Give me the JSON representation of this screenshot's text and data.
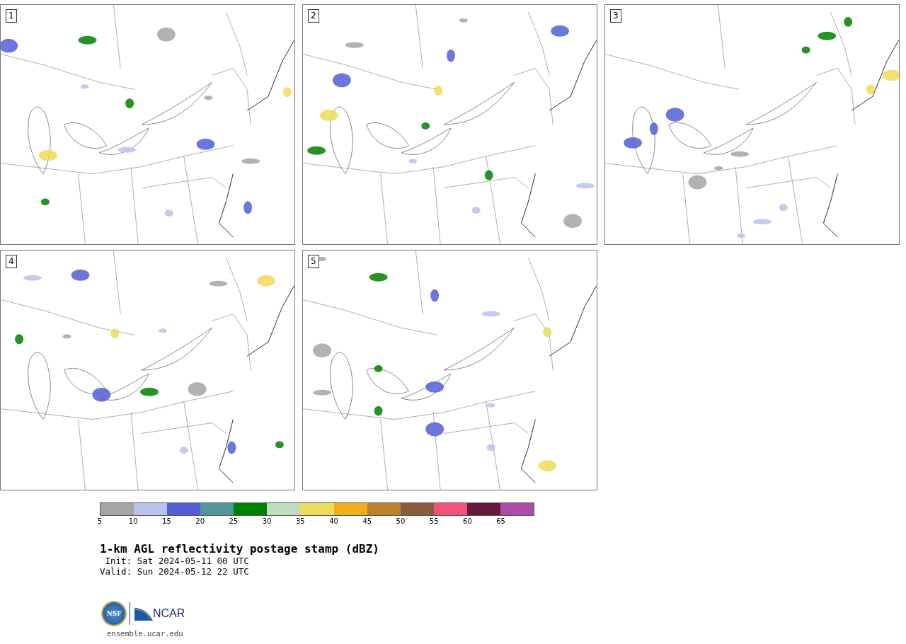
{
  "panels": [
    {
      "label": "1"
    },
    {
      "label": "2"
    },
    {
      "label": "3"
    },
    {
      "label": "4"
    },
    {
      "label": "5"
    }
  ],
  "colorbar": {
    "colors": [
      {
        "color": "#a5a5a5"
      },
      {
        "color": "#b8c2ec"
      },
      {
        "color": "#545ed6"
      },
      {
        "color": "#52969a"
      },
      {
        "color": "#008000"
      },
      {
        "color": "#bfdcbd"
      },
      {
        "color": "#efdc5c"
      },
      {
        "color": "#f0ae18"
      },
      {
        "color": "#ba8230"
      },
      {
        "color": "#8b5b3e"
      },
      {
        "color": "#f4517a"
      },
      {
        "color": "#63193b"
      },
      {
        "color": "#ad4ba8"
      }
    ],
    "ticks": [
      "5",
      "10",
      "15",
      "20",
      "25",
      "30",
      "35",
      "40",
      "45",
      "50",
      "55",
      "60",
      "65"
    ]
  },
  "title": "1-km AGL reflectivity postage stamp (dBZ)",
  "init": " Init: Sat 2024-05-11 00 UTC",
  "valid": "Valid: Sun 2024-05-12 22 UTC",
  "logo": {
    "nsf": "NSF",
    "ncar": "NCAR"
  },
  "url": "ensemble.ucar.edu"
}
